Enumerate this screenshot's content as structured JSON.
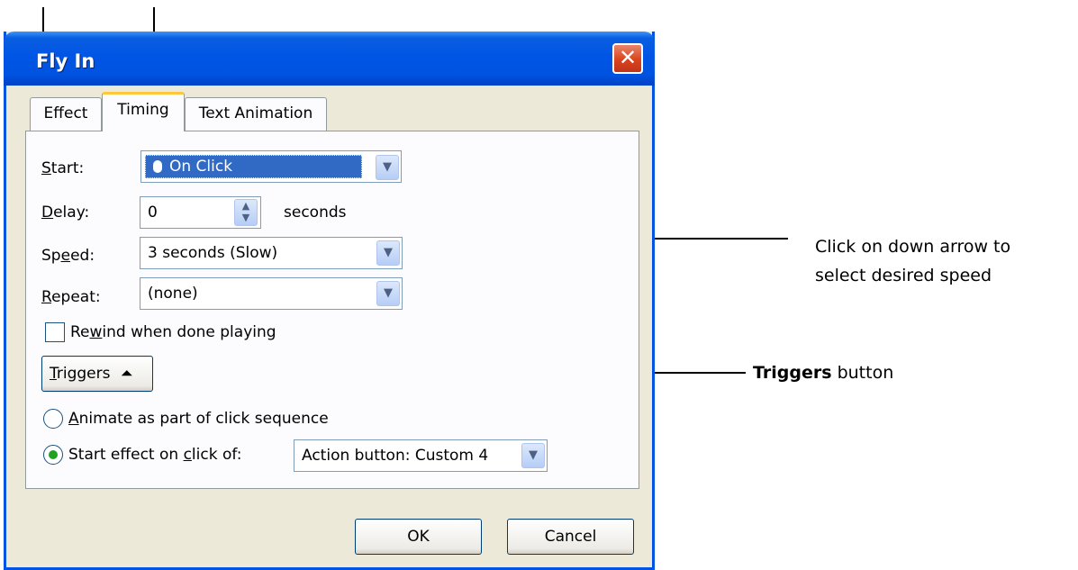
{
  "dialog": {
    "title": "Fly In",
    "close_glyph": "✕"
  },
  "tabs": [
    {
      "label": "Effect",
      "active": false
    },
    {
      "label": "Timing",
      "active": true
    },
    {
      "label": "Text Animation",
      "active": false
    }
  ],
  "timing": {
    "start": {
      "label": "Start:",
      "value": "On Click",
      "icon": "mouse-icon"
    },
    "delay": {
      "label": "Delay:",
      "value": "0",
      "unit": "seconds"
    },
    "speed": {
      "label": "Speed:",
      "value": "3 seconds (Slow)"
    },
    "repeat": {
      "label": "Repeat:",
      "value": "(none)"
    },
    "rewind": {
      "label": "Rewind when done playing",
      "checked": false
    }
  },
  "triggers": {
    "button_label": "Triggers",
    "button_glyph": "⏶",
    "option_animate": {
      "label": "Animate as part of click sequence",
      "selected": false
    },
    "option_start": {
      "label": "Start effect on click of:",
      "selected": true
    },
    "click_of_value": "Action button: Custom 4"
  },
  "buttons": {
    "ok": "OK",
    "cancel": "Cancel"
  },
  "callouts": {
    "speed_line1": "Click on down arrow to",
    "speed_line2": "select desired speed",
    "triggers_bold": "Triggers",
    "triggers_rest": " button"
  },
  "colors": {
    "title_bar": "#0055e5",
    "selection": "#316ac5",
    "active_tab_accent": "#ffc83c",
    "dialog_bg": "#ece9d8"
  }
}
